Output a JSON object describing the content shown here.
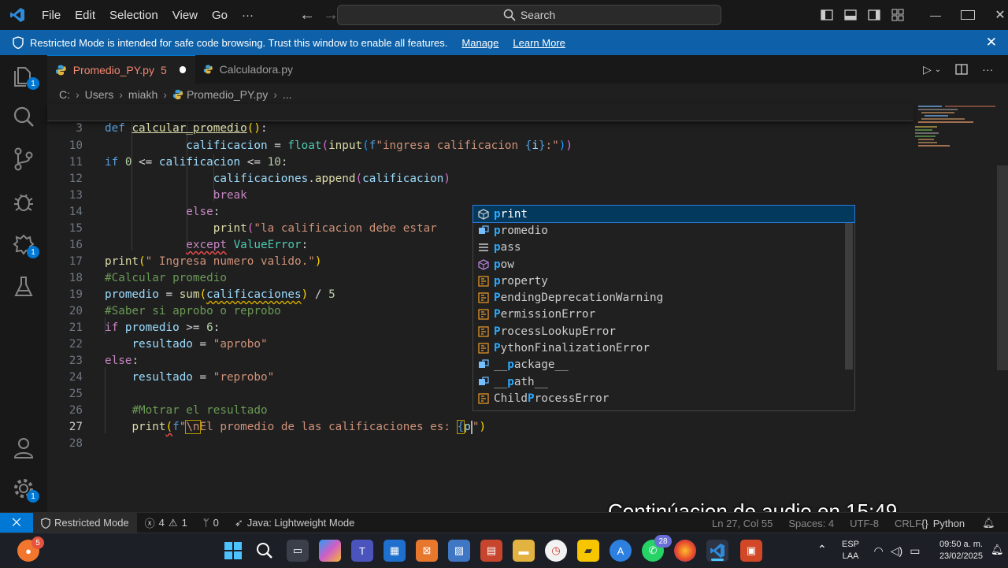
{
  "titlebar": {
    "menu": [
      "File",
      "Edit",
      "Selection",
      "View",
      "Go",
      "···"
    ],
    "search_label": "Search"
  },
  "banner": {
    "message": "Restricted Mode is intended for safe code browsing. Trust this window to enable all features.",
    "manage": "Manage",
    "learn_more": "Learn More"
  },
  "activity": {
    "explorer_badge": "1",
    "extensions_badge": "1",
    "settings_badge": "1"
  },
  "tabs": [
    {
      "label": "Promedio_PY.py",
      "problems": "5",
      "modified": true
    },
    {
      "label": "Calculadora.py"
    }
  ],
  "breadcrumb": [
    "C:",
    "Users",
    "miakh",
    "Promedio_PY.py",
    "..."
  ],
  "sticky": {
    "line_number": "3"
  },
  "lines": [
    {
      "n": "10"
    },
    {
      "n": "11"
    },
    {
      "n": "12"
    },
    {
      "n": "13"
    },
    {
      "n": "14"
    },
    {
      "n": "15"
    },
    {
      "n": "16"
    },
    {
      "n": "17"
    },
    {
      "n": "18"
    },
    {
      "n": "19"
    },
    {
      "n": "20"
    },
    {
      "n": "21"
    },
    {
      "n": "22"
    },
    {
      "n": "23"
    },
    {
      "n": "24"
    },
    {
      "n": "25"
    },
    {
      "n": "26"
    },
    {
      "n": "27"
    },
    {
      "n": "28"
    }
  ],
  "suggestions": [
    {
      "match": "p",
      "rest": "rint",
      "icon": "keyword-icon"
    },
    {
      "match": "p",
      "rest": "romedio",
      "icon": "variable-icon"
    },
    {
      "match": "p",
      "rest": "ass",
      "icon": "keyword-icon"
    },
    {
      "match": "p",
      "rest": "ow",
      "icon": "function-icon"
    },
    {
      "match": "p",
      "rest": "roperty",
      "icon": "class-icon"
    },
    {
      "match": "P",
      "rest": "endingDeprecationWarning",
      "icon": "class-icon"
    },
    {
      "match": "P",
      "rest": "ermissionError",
      "icon": "class-icon"
    },
    {
      "match": "P",
      "rest": "rocessLookupError",
      "icon": "class-icon"
    },
    {
      "match": "P",
      "rest": "ythonFinalizationError",
      "icon": "class-icon"
    },
    {
      "pre": "__",
      "match": "p",
      "rest": "ackage__",
      "icon": "variable-icon"
    },
    {
      "pre": "__",
      "match": "p",
      "rest": "ath__",
      "icon": "variable-icon"
    },
    {
      "pre": "Child",
      "match": "P",
      "rest": "rocessError",
      "icon": "class-icon"
    }
  ],
  "caption": "Continúacion de audio en 15:49",
  "statusbar": {
    "restricted": "Restricted Mode",
    "errors": "4",
    "warnings": "1",
    "ports": "0",
    "java": "Java: Lightweight Mode",
    "position": "Ln 27, Col 55",
    "spaces": "Spaces: 4",
    "encoding": "UTF-8",
    "eol": "CRLF",
    "language": "Python"
  },
  "taskbar": {
    "whatsapp_badge": "28",
    "lang_top": "ESP",
    "lang_bottom": "LAA",
    "time": "09:50 a. m.",
    "date": "23/02/2025",
    "notif_badge": "5"
  },
  "colors": {
    "accent": "#0078d4",
    "banner": "#0e61a8",
    "error": "#f48771"
  }
}
